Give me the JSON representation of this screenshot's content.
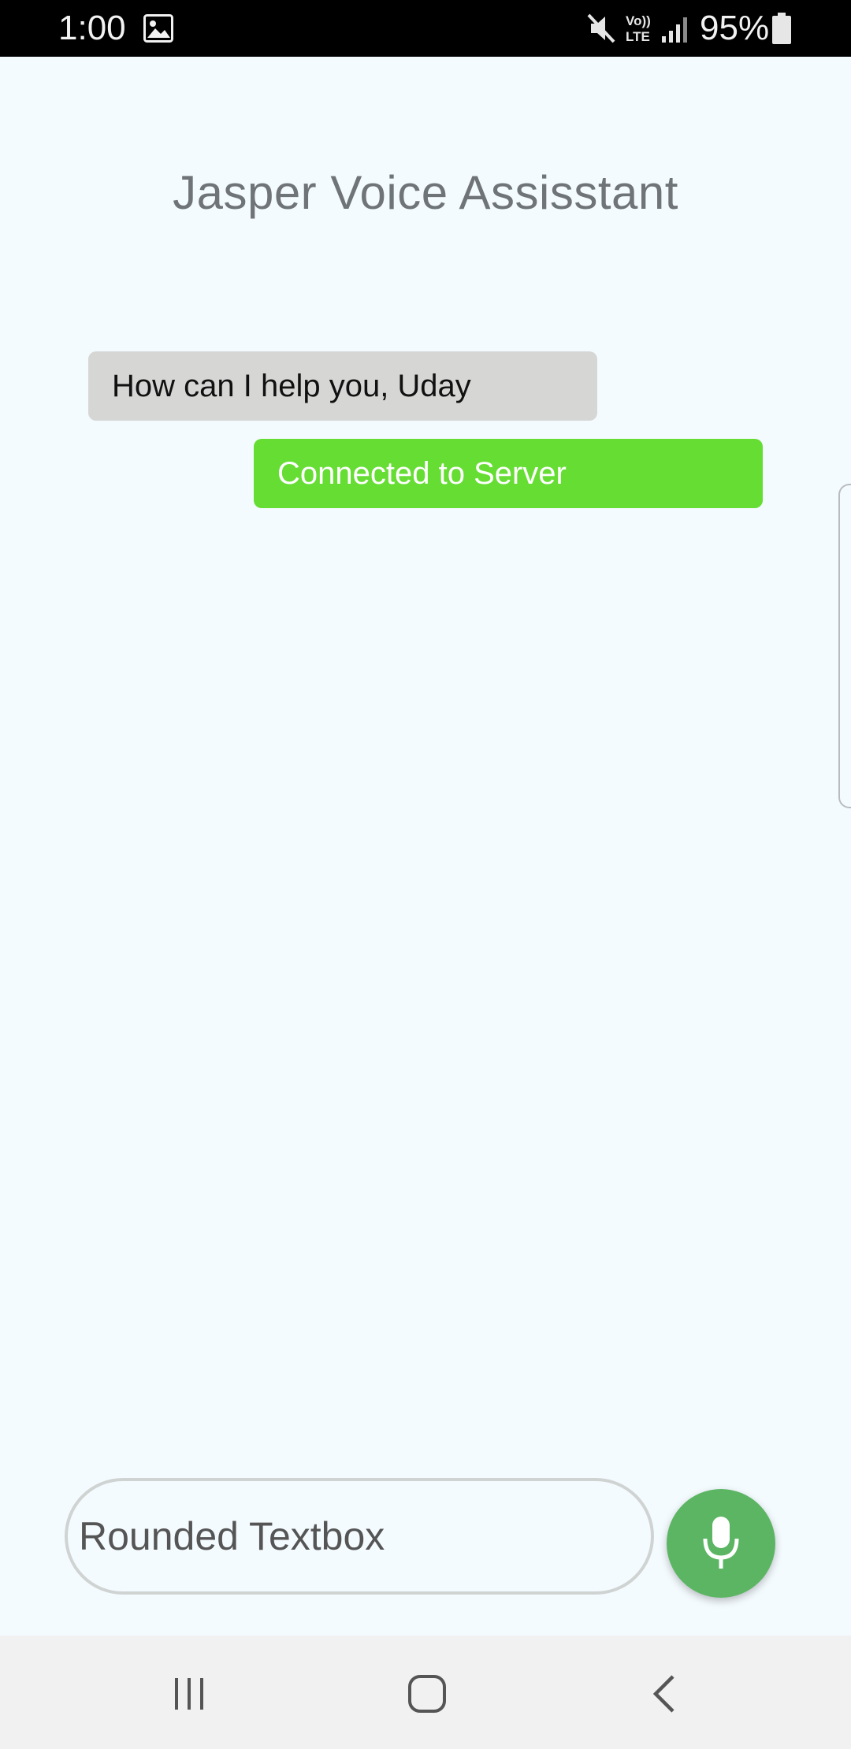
{
  "status_bar": {
    "time": "1:00",
    "battery_percent": "95%",
    "icons": [
      "gallery-icon",
      "mute-icon",
      "volte-icon",
      "signal-icon",
      "battery-icon"
    ]
  },
  "app": {
    "title": "Jasper Voice Assisstant"
  },
  "messages": [
    {
      "type": "incoming",
      "text": "How can I help you, Uday",
      "color": "#d6d7d5"
    },
    {
      "type": "outgoing",
      "text": "Connected to Server",
      "color": "#66dd33"
    }
  ],
  "input": {
    "placeholder": "Rounded Textbox"
  },
  "mic_button": {
    "icon": "microphone-icon",
    "color": "#5cb563"
  },
  "nav_bar": {
    "icons": [
      "recents-icon",
      "home-icon",
      "back-icon"
    ]
  }
}
